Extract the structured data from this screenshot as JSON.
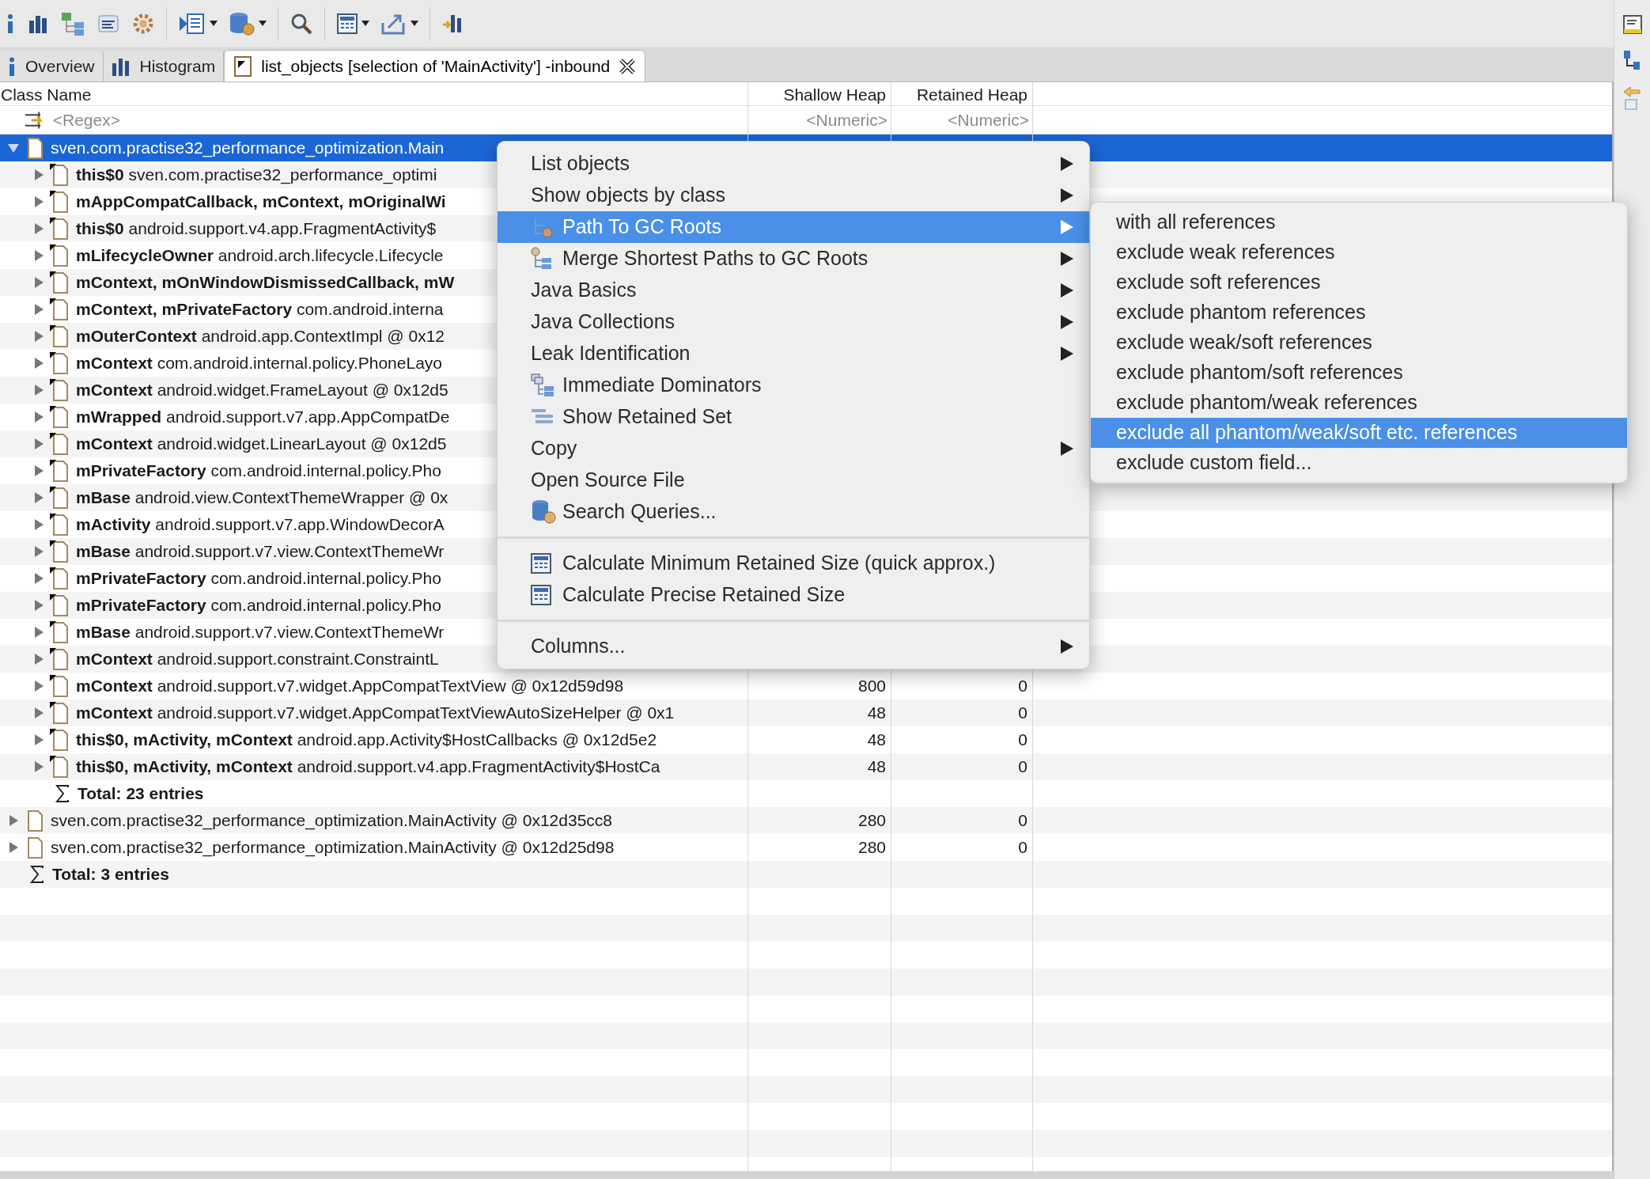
{
  "tabs": [
    {
      "label": "Overview",
      "selected": false,
      "closable": false
    },
    {
      "label": "Histogram",
      "selected": false,
      "closable": false
    },
    {
      "label": "list_objects [selection of 'MainActivity'] -inbound",
      "selected": true,
      "closable": true
    }
  ],
  "table": {
    "columns": [
      {
        "label": "Class Name",
        "placeholder": "<Regex>"
      },
      {
        "label": "Shallow Heap",
        "placeholder": "<Numeric>"
      },
      {
        "label": "Retained Heap",
        "placeholder": "<Numeric>"
      }
    ],
    "rows": [
      {
        "kind": "object",
        "name": "sven.com.practise32_performance_optimization.Main",
        "selected": true,
        "expanded": true,
        "children": [
          {
            "kind": "object",
            "field": "this$0",
            "name": "sven.com.practise32_performance_optimi",
            "selected": false,
            "expanded": false
          },
          {
            "kind": "object",
            "field": "mAppCompatCallback, mContext, mOriginalWi",
            "selected": false,
            "expanded": false
          },
          {
            "kind": "object",
            "field": "this$0",
            "name": "android.support.v4.app.FragmentActivity$",
            "selected": false,
            "expanded": false
          },
          {
            "kind": "object",
            "field": "mLifecycleOwner",
            "name": "android.arch.lifecycle.Lifecycle",
            "selected": false,
            "expanded": false
          },
          {
            "kind": "object",
            "field": "mContext, mOnWindowDismissedCallback, mW",
            "selected": false,
            "expanded": false
          },
          {
            "kind": "object",
            "field": "mContext, mPrivateFactory",
            "name": "com.android.interna",
            "selected": false,
            "expanded": false
          },
          {
            "kind": "object",
            "field": "mOuterContext",
            "name": "android.app.ContextImpl @ 0x12",
            "selected": false,
            "expanded": false
          },
          {
            "kind": "object",
            "field": "mContext",
            "name": "com.android.internal.policy.PhoneLayo",
            "selected": false,
            "expanded": false
          },
          {
            "kind": "object",
            "field": "mContext",
            "name": "android.widget.FrameLayout @ 0x12d5",
            "selected": false,
            "expanded": false
          },
          {
            "kind": "object",
            "field": "mWrapped",
            "name": "android.support.v7.app.AppCompatDe",
            "selected": false,
            "expanded": false
          },
          {
            "kind": "object",
            "field": "mContext",
            "name": "android.widget.LinearLayout @ 0x12d5",
            "selected": false,
            "expanded": false
          },
          {
            "kind": "object",
            "field": "mPrivateFactory",
            "name": "com.android.internal.policy.Pho",
            "selected": false,
            "expanded": false
          },
          {
            "kind": "object",
            "field": "mBase",
            "name": "android.view.ContextThemeWrapper @ 0x",
            "selected": false,
            "expanded": false
          },
          {
            "kind": "object",
            "field": "mActivity",
            "name": "android.support.v7.app.WindowDecorA",
            "selected": false,
            "expanded": false
          },
          {
            "kind": "object",
            "field": "mBase",
            "name": "android.support.v7.view.ContextThemeWr",
            "selected": false,
            "expanded": false
          },
          {
            "kind": "object",
            "field": "mPrivateFactory",
            "name": "com.android.internal.policy.Pho",
            "selected": false,
            "expanded": false
          },
          {
            "kind": "object",
            "field": "mPrivateFactory",
            "name": "com.android.internal.policy.Pho",
            "selected": false,
            "expanded": false
          },
          {
            "kind": "object",
            "field": "mBase",
            "name": "android.support.v7.view.ContextThemeWr",
            "selected": false,
            "expanded": false
          },
          {
            "kind": "object",
            "field": "mContext",
            "name": "android.support.constraint.ConstraintL",
            "selected": false,
            "expanded": false
          },
          {
            "kind": "object",
            "field": "mContext",
            "name": "android.support.v7.widget.AppCompatTextView @ 0x12d59d98",
            "shallow": "800",
            "retained": "0",
            "selected": false,
            "expanded": false
          },
          {
            "kind": "object",
            "field": "mContext",
            "name": "android.support.v7.widget.AppCompatTextViewAutoSizeHelper @ 0x1",
            "shallow": "48",
            "retained": "0",
            "selected": false,
            "expanded": false
          },
          {
            "kind": "object",
            "field": "this$0, mActivity, mContext",
            "name": "android.app.Activity$HostCallbacks @ 0x12d5e2",
            "shallow": "48",
            "retained": "0",
            "selected": false,
            "expanded": false
          },
          {
            "kind": "object",
            "field": "this$0, mActivity, mContext",
            "name": "android.support.v4.app.FragmentActivity$HostCa",
            "shallow": "48",
            "retained": "0",
            "selected": false,
            "expanded": false
          },
          {
            "kind": "total",
            "name": "Total: 23 entries"
          }
        ]
      },
      {
        "kind": "object",
        "name": "sven.com.practise32_performance_optimization.MainActivity @ 0x12d35cc8",
        "shallow": "280",
        "retained": "0",
        "selected": false,
        "expanded": false
      },
      {
        "kind": "object",
        "name": "sven.com.practise32_performance_optimization.MainActivity @ 0x12d25d98",
        "shallow": "280",
        "retained": "0",
        "selected": false,
        "expanded": false
      },
      {
        "kind": "total",
        "name": "Total: 3 entries"
      }
    ]
  },
  "context_menu": {
    "sections": [
      {
        "items": [
          {
            "label": "List objects",
            "has_icon": false,
            "submenu": true,
            "selected": false
          },
          {
            "label": "Show objects by class",
            "has_icon": false,
            "submenu": true,
            "selected": false
          },
          {
            "label": "Path To GC Roots",
            "has_icon": true,
            "submenu": true,
            "selected": true
          },
          {
            "label": "Merge Shortest Paths to GC Roots",
            "has_icon": true,
            "submenu": true,
            "selected": false
          },
          {
            "label": "Java Basics",
            "has_icon": false,
            "submenu": true,
            "selected": false
          },
          {
            "label": "Java Collections",
            "has_icon": false,
            "submenu": true,
            "selected": false
          },
          {
            "label": "Leak Identification",
            "has_icon": false,
            "submenu": true,
            "selected": false
          },
          {
            "label": "Immediate Dominators",
            "has_icon": true,
            "submenu": false,
            "selected": false
          },
          {
            "label": "Show Retained Set",
            "has_icon": true,
            "submenu": false,
            "selected": false
          },
          {
            "label": "Copy",
            "has_icon": false,
            "submenu": true,
            "selected": false
          },
          {
            "label": "Open Source File",
            "has_icon": false,
            "submenu": false,
            "selected": false
          },
          {
            "label": "Search Queries...",
            "has_icon": true,
            "submenu": false,
            "selected": false
          }
        ]
      },
      {
        "items": [
          {
            "label": "Calculate Minimum Retained Size (quick approx.)",
            "has_icon": true,
            "submenu": false,
            "selected": false
          },
          {
            "label": "Calculate Precise Retained Size",
            "has_icon": true,
            "submenu": false,
            "selected": false
          }
        ]
      },
      {
        "items": [
          {
            "label": "Columns...",
            "has_icon": false,
            "submenu": true,
            "selected": false
          }
        ]
      }
    ]
  },
  "submenu": {
    "items": [
      {
        "label": "with all references",
        "selected": false
      },
      {
        "label": "exclude weak references",
        "selected": false
      },
      {
        "label": "exclude soft references",
        "selected": false
      },
      {
        "label": "exclude phantom references",
        "selected": false
      },
      {
        "label": "exclude weak/soft references",
        "selected": false
      },
      {
        "label": "exclude phantom/soft references",
        "selected": false
      },
      {
        "label": "exclude phantom/weak references",
        "selected": false
      },
      {
        "label": "exclude all phantom/weak/soft etc. references",
        "selected": true
      },
      {
        "label": "exclude custom field...",
        "selected": false
      }
    ]
  }
}
